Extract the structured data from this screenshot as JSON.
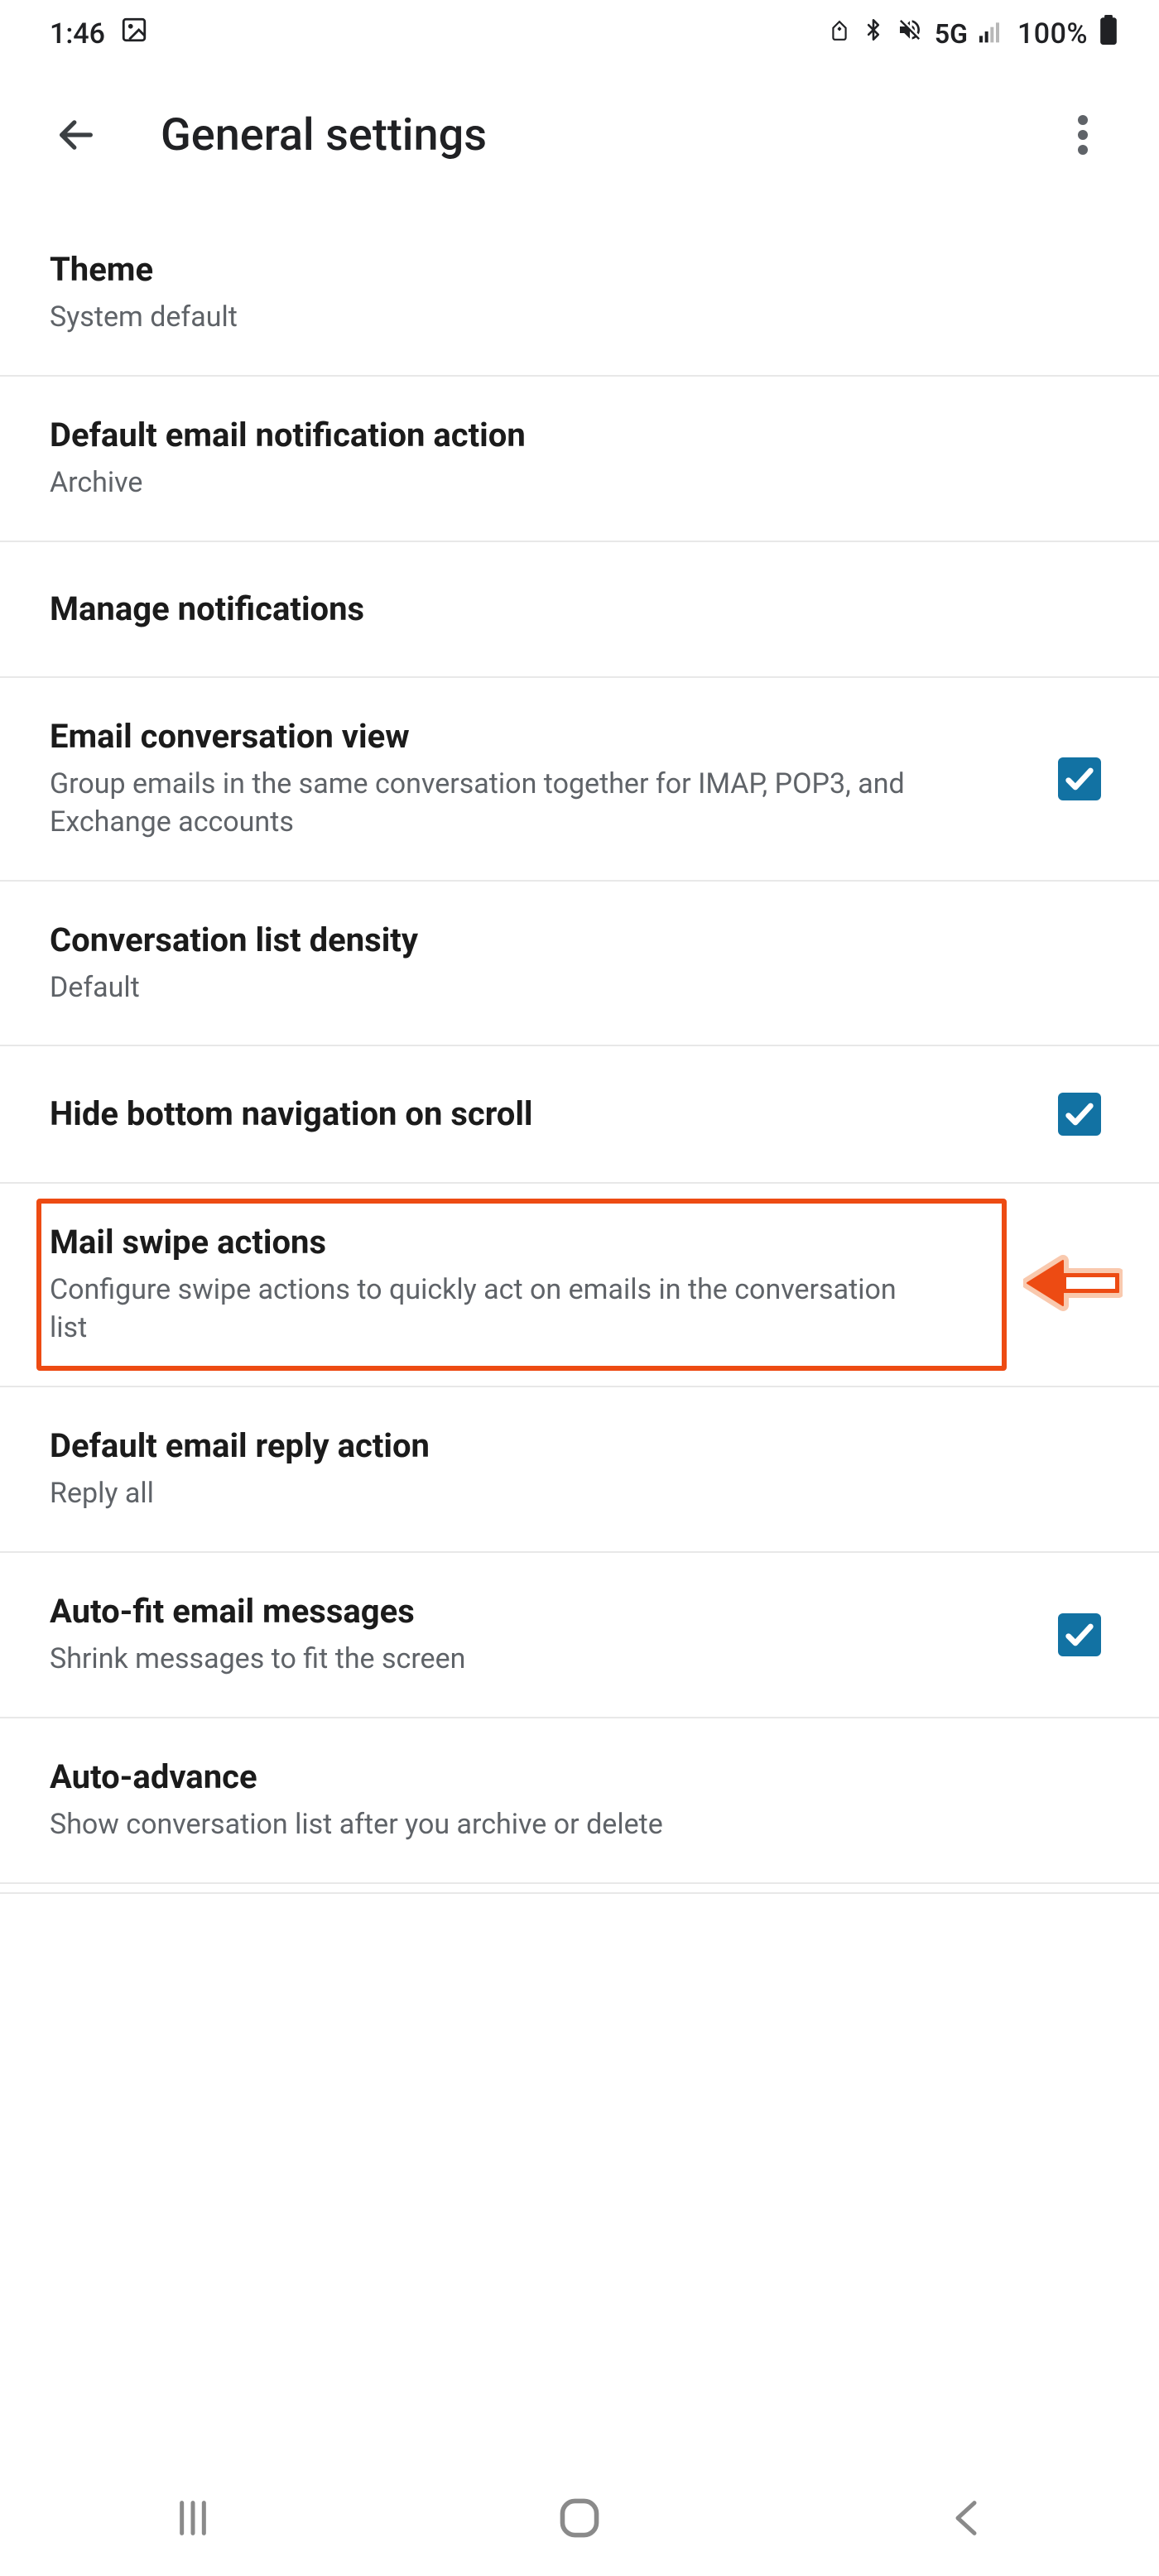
{
  "status": {
    "time": "1:46",
    "network": "5G",
    "battery_pct": "100%"
  },
  "header": {
    "title": "General settings"
  },
  "settings": {
    "theme": {
      "title": "Theme",
      "sub": "System default"
    },
    "notif_action": {
      "title": "Default email notification action",
      "sub": "Archive"
    },
    "manage_notifs": {
      "title": "Manage notifications"
    },
    "conversation_view": {
      "title": "Email conversation view",
      "sub": "Group emails in the same conversation together for IMAP, POP3, and Exchange accounts",
      "checked": true
    },
    "density": {
      "title": "Conversation list density",
      "sub": "Default"
    },
    "hide_bottom_nav": {
      "title": "Hide bottom navigation on scroll",
      "checked": true
    },
    "swipe_actions": {
      "title": "Mail swipe actions",
      "sub": "Configure swipe actions to quickly act on emails in the conversation list"
    },
    "reply_action": {
      "title": "Default email reply action",
      "sub": "Reply all"
    },
    "auto_fit": {
      "title": "Auto-fit email messages",
      "sub": "Shrink messages to fit the screen",
      "checked": true
    },
    "auto_advance": {
      "title": "Auto-advance",
      "sub": "Show conversation list after you archive or delete"
    }
  },
  "annotation": {
    "highlight_color": "#ed4b13",
    "arrow_color": "#ed4b13"
  }
}
